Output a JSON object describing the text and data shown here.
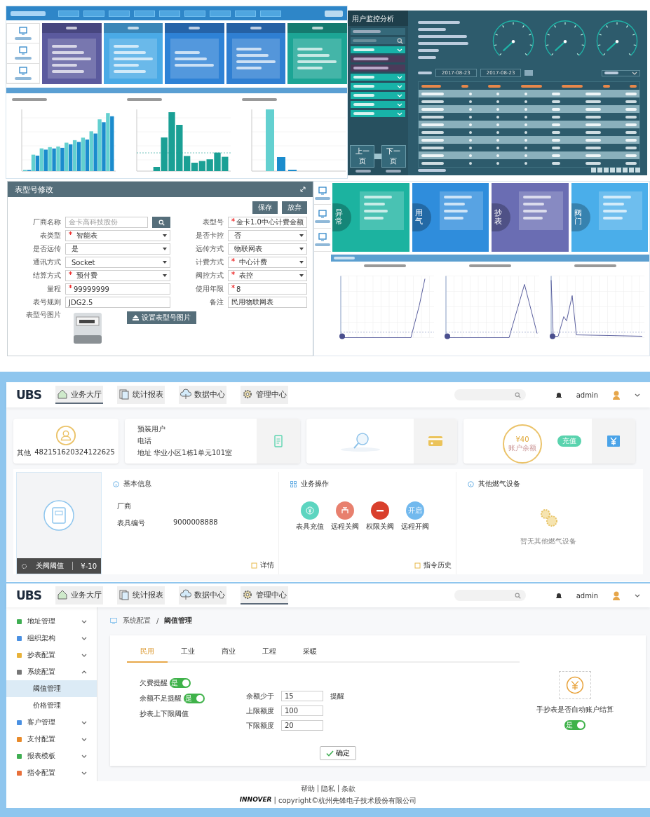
{
  "monitor_panel": {
    "title": "用户监控分析",
    "date_from": "2017-08-23",
    "date_to": "2017-08-23",
    "prev_button": "上一页",
    "next_button": "下一页"
  },
  "model_form": {
    "title": "表型号修改",
    "buttons": [
      "保存",
      "放弃"
    ],
    "fields": [
      {
        "label": "厂商名称",
        "placeholder": "金卡高科技股份",
        "kind": "search",
        "required": false
      },
      {
        "label": "表型号",
        "value": "金卡1.0中心计费金额",
        "kind": "text",
        "required": true
      },
      {
        "label": "表类型",
        "value": "智能表",
        "kind": "select",
        "required": true
      },
      {
        "label": "是否卡控",
        "value": "否",
        "kind": "select",
        "required": false
      },
      {
        "label": "是否远传",
        "value": "是",
        "kind": "select",
        "required": false
      },
      {
        "label": "远传方式",
        "value": "物联网表",
        "kind": "select",
        "required": false
      },
      {
        "label": "通讯方式",
        "value": "Socket",
        "kind": "select",
        "required": false
      },
      {
        "label": "计费方式",
        "value": "中心计费",
        "kind": "select",
        "required": true
      },
      {
        "label": "结算方式",
        "value": "预付费",
        "kind": "select",
        "required": true
      },
      {
        "label": "阀控方式",
        "value": "表控",
        "kind": "select",
        "required": true
      },
      {
        "label": "量程",
        "value": "99999999",
        "kind": "text",
        "required": true
      },
      {
        "label": "使用年限",
        "value": "8",
        "kind": "text",
        "required": true
      },
      {
        "label": "表号规则",
        "value": "JDG2.5",
        "kind": "text",
        "required": false
      },
      {
        "label": "备注",
        "value": "民用物联网表",
        "kind": "text",
        "required": false
      }
    ],
    "image_label": "表型号图片",
    "upload_button": "设置表型号图片"
  },
  "stats_panel": {
    "cards": [
      {
        "label": "异常",
        "color": "#1cb3a0"
      },
      {
        "label": "用气",
        "color": "#2f8ddc"
      },
      {
        "label": "抄表",
        "color": "#6a6db3"
      },
      {
        "label": "阀门",
        "color": "#4aaeea"
      }
    ]
  },
  "business_hall": {
    "logo": "UBS",
    "nav": [
      {
        "label": "业务大厅",
        "selected": true
      },
      {
        "label": "统计报表",
        "selected": false
      },
      {
        "label": "数据中心",
        "selected": false
      },
      {
        "label": "管理中心",
        "selected": false
      }
    ],
    "user": "admin",
    "customer": {
      "type": "其他",
      "id": "482151620324122625"
    },
    "contact": [
      "预装用户",
      "电话",
      "地址 华业小区1栋1单元101室"
    ],
    "balance": {
      "amount": "¥40",
      "caption": "账户余额",
      "badge": "充值"
    },
    "meter": {
      "valve_label": "关阀阈值",
      "valve_value": "¥-10"
    },
    "basic_info": {
      "title": "基本信息",
      "rows": [
        {
          "label": "厂商"
        },
        {
          "label": "表具编号",
          "value": "9000008888"
        }
      ],
      "link": "详情"
    },
    "operations": {
      "title": "业务操作",
      "actions": [
        {
          "label": "表具充值",
          "kind": "recharge",
          "color": "#5dd5c0"
        },
        {
          "label": "远程关阀",
          "kind": "valve",
          "color": "#e8806e"
        },
        {
          "label": "权限关阀",
          "kind": "block",
          "color": "#d93f2c"
        },
        {
          "label": "远程开阀",
          "kind": "text",
          "color": "#72b9ee",
          "icon_text": "开启"
        }
      ],
      "link": "指令历史"
    },
    "other_devices": {
      "title": "其他燃气设备",
      "empty": "暂无其他燃气设备"
    }
  },
  "threshold_settings": {
    "logo": "UBS",
    "nav": [
      {
        "label": "业务大厅",
        "selected": false
      },
      {
        "label": "统计报表",
        "selected": false
      },
      {
        "label": "数据中心",
        "selected": false
      },
      {
        "label": "管理中心",
        "selected": true
      }
    ],
    "user": "admin",
    "sidebar": [
      {
        "label": "地址管理",
        "expanded": false
      },
      {
        "label": "组织架构",
        "expanded": false
      },
      {
        "label": "抄表配置",
        "expanded": false
      },
      {
        "label": "系统配置",
        "expanded": true,
        "children": [
          {
            "label": "阈值管理",
            "selected": true
          },
          {
            "label": "价格管理",
            "selected": false
          }
        ]
      },
      {
        "label": "客户管理",
        "expanded": false
      },
      {
        "label": "支付配置",
        "expanded": false
      },
      {
        "label": "报表模板",
        "expanded": false
      },
      {
        "label": "指令配置",
        "expanded": false
      }
    ],
    "breadcrumb": [
      "系统配置",
      "阈值管理"
    ],
    "breadcrumb_separator": "/",
    "tabs": [
      {
        "label": "民用",
        "selected": true
      },
      {
        "label": "工业",
        "selected": false
      },
      {
        "label": "商业",
        "selected": false
      },
      {
        "label": "工程",
        "selected": false
      },
      {
        "label": "采暖",
        "selected": false
      }
    ],
    "toggles": [
      {
        "label": "欠费提醒",
        "on": true,
        "text": "是"
      },
      {
        "label": "余额不足提醒",
        "on": true,
        "text": "是"
      }
    ],
    "limit_label": "抄表上下限阈值",
    "fields": [
      {
        "label": "余额少于",
        "value": "15",
        "suffix": "提醒"
      },
      {
        "label": "上限额度",
        "value": "100"
      },
      {
        "label": "下限额度",
        "value": "20"
      }
    ],
    "confirm": "确定",
    "auto_settle": {
      "label": "手抄表是否自动账户结算",
      "on": true,
      "text": "是"
    },
    "footer": {
      "links": [
        "帮助",
        "隐私",
        "条款"
      ],
      "separator": "|",
      "brand": "INNOVER",
      "copyright": "copyright©杭州先锋电子技术股份有限公司"
    }
  }
}
